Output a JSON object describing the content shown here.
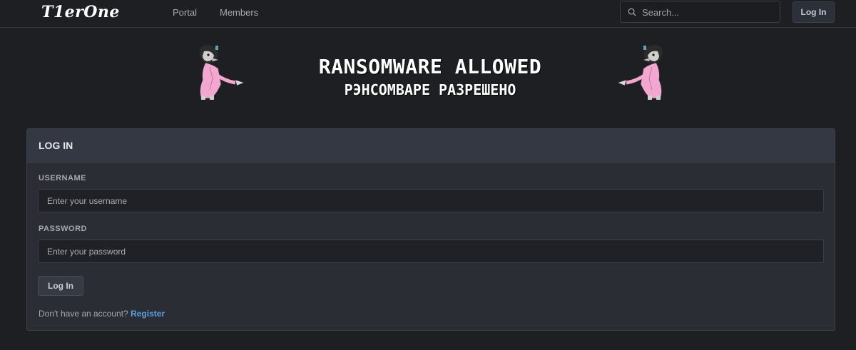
{
  "header": {
    "logo_text": "T1erOne",
    "nav": [
      {
        "label": "Portal"
      },
      {
        "label": "Members"
      }
    ],
    "search_placeholder": "Search...",
    "login_label": "Log In"
  },
  "banner": {
    "title": "RANSOMWARE ALLOWED",
    "subtitle": "РЭНСОМВАРЕ РАЗРЕШЕНО",
    "mascot_icon": "wolf-cartoon-icon"
  },
  "login_panel": {
    "title": "LOG IN",
    "username_label": "USERNAME",
    "username_placeholder": "Enter your username",
    "password_label": "PASSWORD",
    "password_placeholder": "Enter your password",
    "submit_label": "Log In",
    "register_prompt": "Don't have an account?",
    "register_link": "Register"
  },
  "colors": {
    "background": "#1d1f23",
    "panel": "#2a2d33",
    "panel_header": "#343842",
    "link": "#5aa0e0"
  }
}
